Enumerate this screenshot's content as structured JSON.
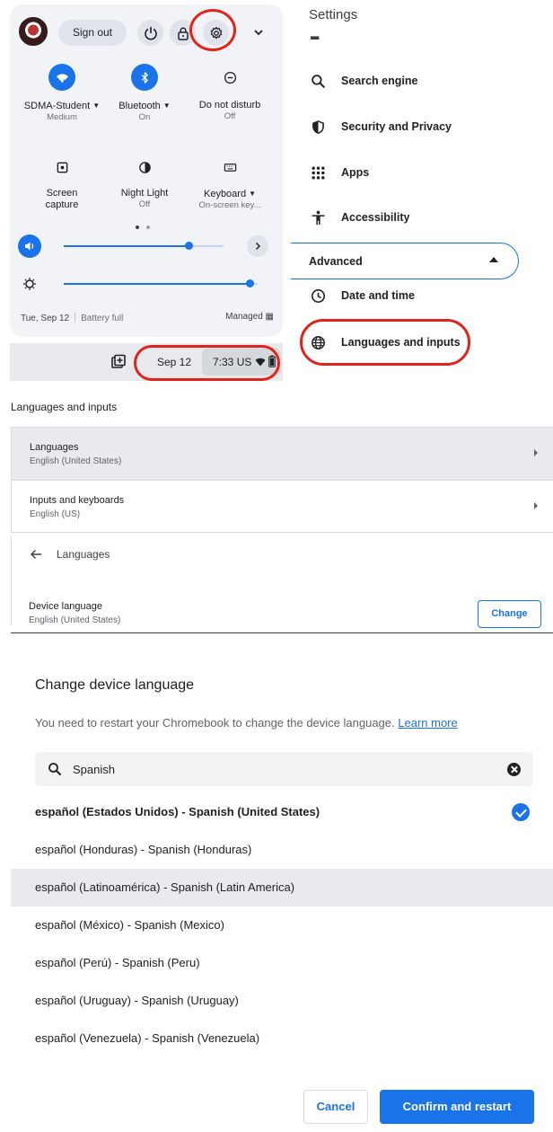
{
  "quick_settings": {
    "sign_out": "Sign out",
    "tiles": [
      {
        "label": "SDMA-Student",
        "sub": "Medium",
        "has_menu": true,
        "state": "on",
        "icon": "wifi-icon"
      },
      {
        "label": "Bluetooth",
        "sub": "On",
        "has_menu": true,
        "state": "on",
        "icon": "bluetooth-icon"
      },
      {
        "label": "Do not disturb",
        "sub": "Off",
        "has_menu": false,
        "state": "off",
        "icon": "do-not-disturb-icon"
      },
      {
        "label": "Screen",
        "label2": "capture",
        "sub": "",
        "has_menu": false,
        "state": "off",
        "icon": "screen-capture-icon"
      },
      {
        "label": "Night Light",
        "sub": "Off",
        "has_menu": false,
        "state": "off",
        "icon": "night-light-icon"
      },
      {
        "label": "Keyboard",
        "sub": "On-screen key...",
        "has_menu": true,
        "state": "off",
        "icon": "keyboard-icon"
      }
    ],
    "volume_level": 0.78,
    "brightness_level": 0.96,
    "footer": {
      "date": "Tue, Sep 12",
      "battery": "Battery full",
      "managed": "Managed"
    }
  },
  "shelf": {
    "date": "Sep 12",
    "time": "7:33",
    "locale": "US"
  },
  "settings": {
    "title": "Settings",
    "nav": [
      {
        "label": "Search engine",
        "icon": "search-icon"
      },
      {
        "label": "Security and Privacy",
        "icon": "shield-icon"
      },
      {
        "label": "Apps",
        "icon": "apps-grid-icon"
      },
      {
        "label": "Accessibility",
        "icon": "accessibility-icon"
      }
    ],
    "advanced": "Advanced",
    "adv_nav": [
      {
        "label": "Date and time",
        "icon": "clock-icon"
      },
      {
        "label": "Languages and inputs",
        "icon": "globe-icon"
      }
    ]
  },
  "languages_inputs": {
    "title": "Languages and inputs",
    "rows": [
      {
        "title": "Languages",
        "sub": "English (United States)"
      },
      {
        "title": "Inputs and keyboards",
        "sub": "English (US)"
      }
    ]
  },
  "languages_page": {
    "title": "Languages",
    "device_language_label": "Device language",
    "device_language_value": "English (United States)",
    "change_label": "Change"
  },
  "dialog": {
    "title": "Change device language",
    "body": "You need to restart your Chromebook to change the device language.",
    "learn_more": "Learn more",
    "search_value": "Spanish",
    "options": [
      "español (Estados Unidos) - Spanish (United States)",
      "español (Honduras) - Spanish (Honduras)",
      "español (Latinoamérica) - Spanish (Latin America)",
      "español (México) - Spanish (Mexico)",
      "español (Perú) - Spanish (Peru)",
      "español (Uruguay) - Spanish (Uruguay)",
      "español (Venezuela) - Spanish (Venezuela)"
    ],
    "selected_index": 0,
    "highlighted_index": 2,
    "cancel": "Cancel",
    "confirm": "Confirm and restart"
  }
}
